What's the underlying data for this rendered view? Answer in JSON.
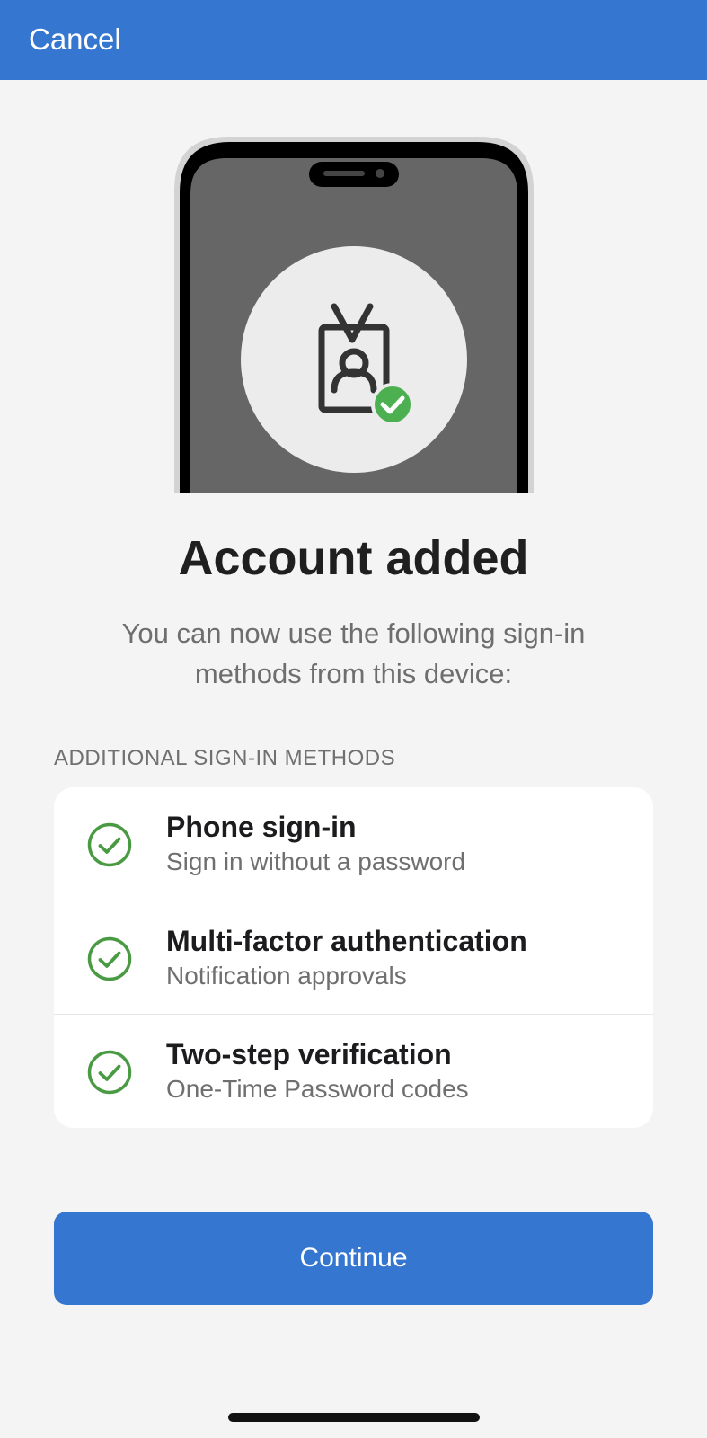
{
  "header": {
    "cancel_label": "Cancel"
  },
  "illustration": {
    "icon": "id-badge-with-check-icon"
  },
  "main": {
    "title": "Account added",
    "subtitle": "You can now use the following sign-in methods from this device:"
  },
  "methods_section": {
    "header": "ADDITIONAL SIGN-IN METHODS",
    "items": [
      {
        "title": "Phone sign-in",
        "description": "Sign in without a password",
        "icon": "check-circle-icon"
      },
      {
        "title": "Multi-factor authentication",
        "description": "Notification approvals",
        "icon": "check-circle-icon"
      },
      {
        "title": "Two-step verification",
        "description": "One-Time Password codes",
        "icon": "check-circle-icon"
      }
    ]
  },
  "footer": {
    "continue_label": "Continue"
  },
  "colors": {
    "brand_blue": "#3476d0",
    "success_green": "#4caf50",
    "background": "#f4f4f4"
  }
}
